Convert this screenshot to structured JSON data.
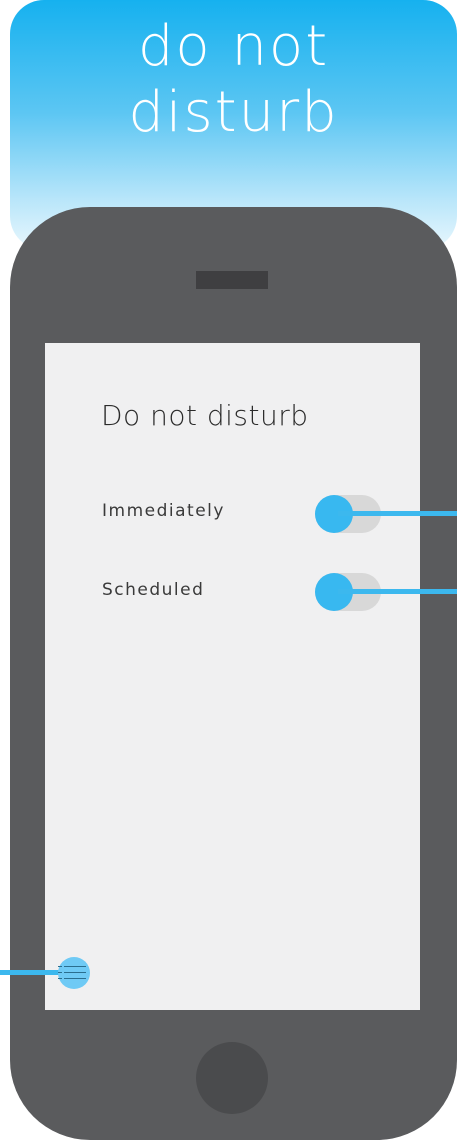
{
  "banner": {
    "title": "do not\ndisturb"
  },
  "screen": {
    "title": "Do not disturb",
    "settings": [
      {
        "label": "Immediately",
        "enabled": false
      },
      {
        "label": "Scheduled",
        "enabled": false
      }
    ]
  },
  "colors": {
    "accent": "#38b8f0",
    "phone_body": "#5a5b5d",
    "screen_bg": "#f0f0f1",
    "toggle_track": "#d8d8d8"
  },
  "icons": {
    "menu": "menu-icon"
  }
}
